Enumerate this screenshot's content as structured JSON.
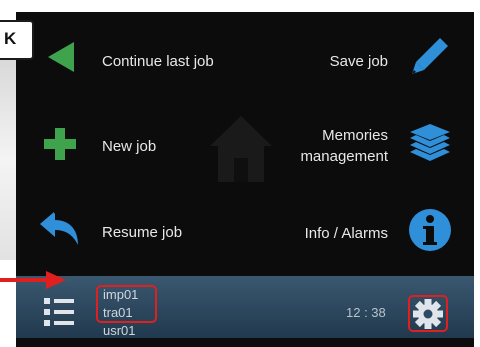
{
  "callout": {
    "text": "K"
  },
  "menu": {
    "continue_last_job": "Continue last job",
    "save_job": "Save job",
    "new_job": "New job",
    "memories_line1": "Memories",
    "memories_line2": "management",
    "resume_job": "Resume job",
    "info_alarms": "Info / Alarms"
  },
  "statusbar": {
    "users": [
      "imp01",
      "tra01",
      "usr01"
    ],
    "time": "12 : 38"
  },
  "colors": {
    "green_icon": "#3fa34d",
    "blue_icon": "#2f8fd8",
    "statusbar": "#2b4a63",
    "highlight": "#e01f1f"
  },
  "icons": {
    "continue": "triangle-left-icon",
    "save": "pencil-icon",
    "new": "plus-icon",
    "memories": "layers-icon",
    "resume": "undo-arrow-icon",
    "info": "info-icon",
    "menu": "list-icon",
    "settings": "gear-icon",
    "home": "home-icon"
  }
}
